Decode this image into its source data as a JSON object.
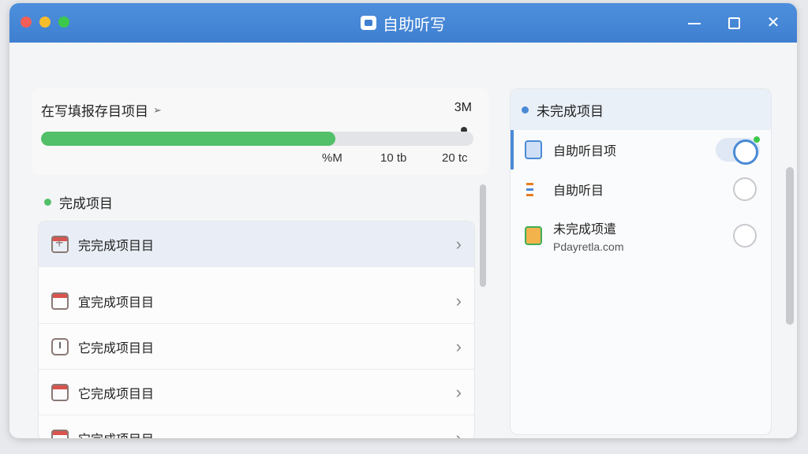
{
  "window": {
    "title": "自助听写"
  },
  "progress": {
    "title": "在写填报存目项目",
    "total": "3M",
    "fill_percent": 68,
    "ticks": [
      "%M",
      "10 tb",
      "20 tc"
    ]
  },
  "done_section": {
    "header": "完成项目",
    "items": [
      {
        "label": "完完成项目目",
        "icon": "plus-calendar-icon"
      },
      {
        "label": "宜完成项目目",
        "icon": "calendar-icon"
      },
      {
        "label": "它完成项目目",
        "icon": "clock-icon"
      },
      {
        "label": "它完成项目目",
        "icon": "calendar-icon"
      },
      {
        "label": "它完成项目目",
        "icon": "calendar-icon"
      }
    ]
  },
  "pending_section": {
    "header": "未完成项目",
    "items": [
      {
        "label": "自助听目项",
        "sub": "",
        "icon": "document-icon",
        "toggle": "on"
      },
      {
        "label": "自助听目",
        "sub": "",
        "icon": "transcribe-icon",
        "toggle": "off"
      },
      {
        "label": "未完成项遣",
        "sub": "Pdayretla.com",
        "icon": "folder-icon",
        "toggle": "off"
      }
    ]
  },
  "colors": {
    "titlebar": "#3f7fd1",
    "progress_fill": "#52c069",
    "accent_blue": "#4a8ad6"
  }
}
